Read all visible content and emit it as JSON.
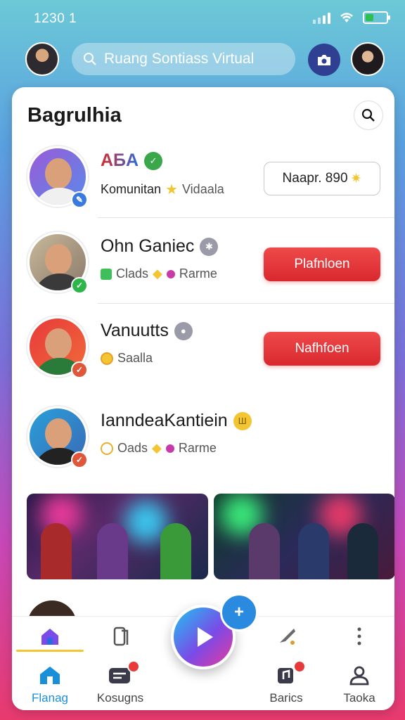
{
  "status": {
    "time": "1230 1"
  },
  "header": {
    "search_placeholder": "Ruang Sontiass Virtual"
  },
  "card": {
    "title": "Bagrulhia"
  },
  "rows": [
    {
      "name_colored": "AБA",
      "sub_text_1": "Komunitan",
      "sub_text_2": "Vidaala",
      "button": "Naapr. 890"
    },
    {
      "name": "Ohn Ganiec",
      "sub_text_1": "Clads",
      "sub_text_2": "Rarme",
      "button": "Plafnloen"
    },
    {
      "name": "Vanuutts",
      "sub_text_1": "Saalla",
      "button": "Nafhfoen"
    },
    {
      "name": "IanndeaKantiein",
      "sub_text_1": "Oads",
      "sub_text_2": "Rarme"
    }
  ],
  "nav": {
    "items": [
      {
        "label": "Flanag"
      },
      {
        "label": "Kosugns"
      },
      {
        "label": "Barics"
      },
      {
        "label": "Taoka"
      }
    ]
  },
  "colors": {
    "accent_blue": "#1a8fd9",
    "red_button": "#d9282f",
    "active_underline": "#f2c531"
  }
}
